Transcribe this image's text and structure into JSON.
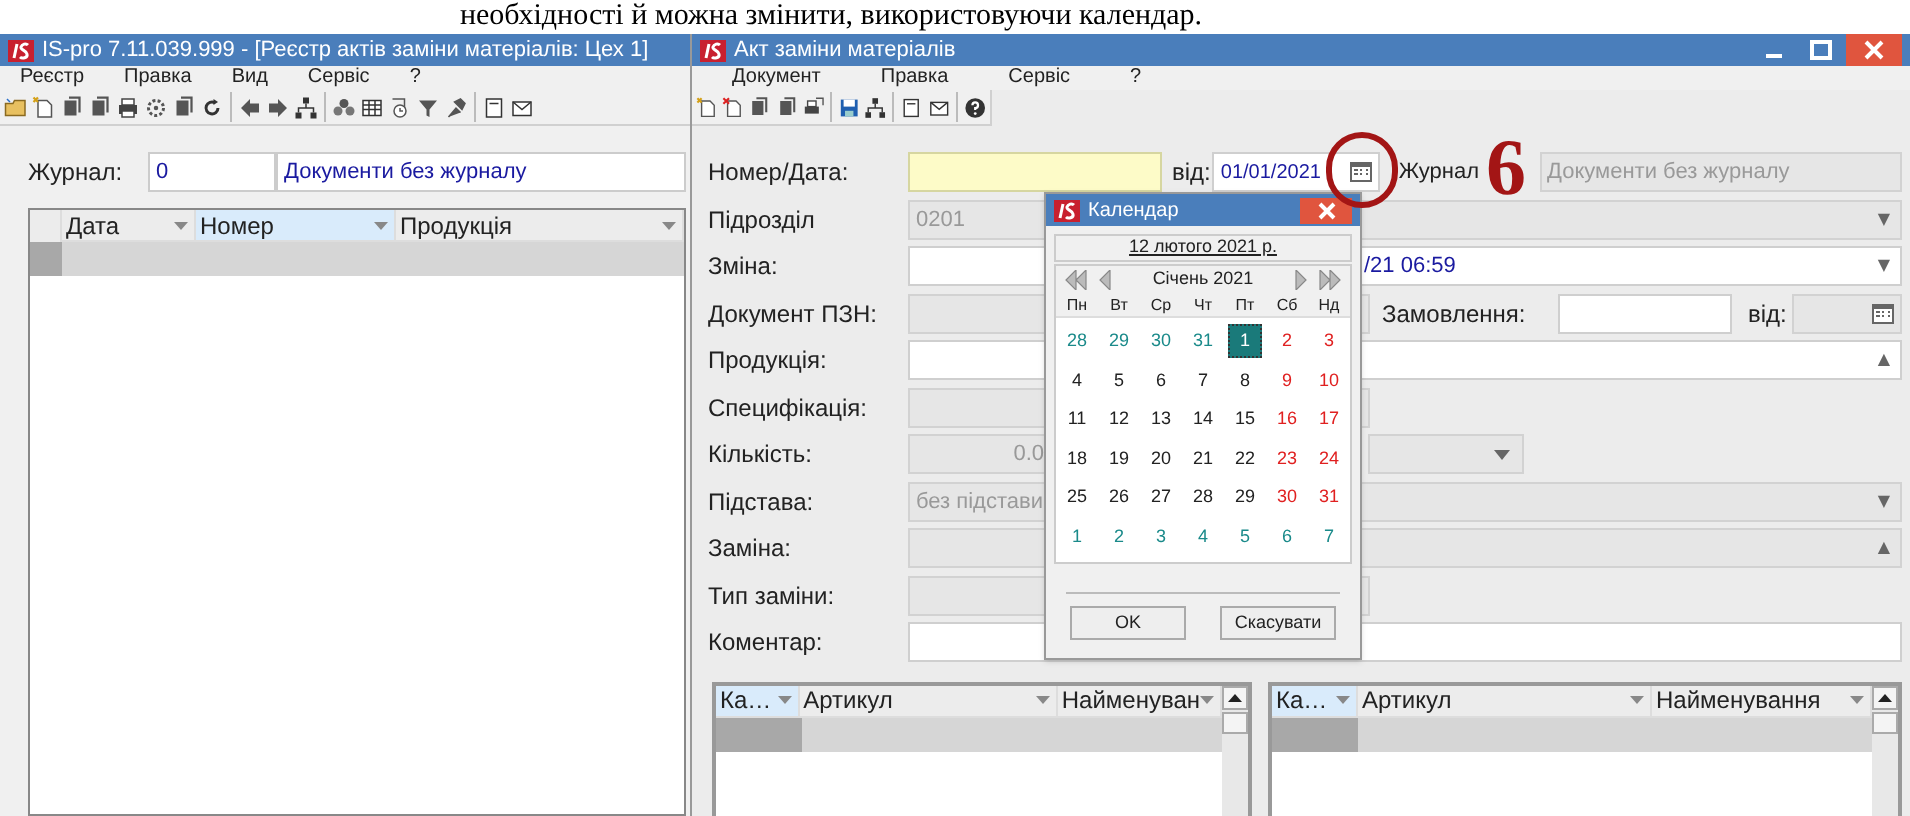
{
  "caption": "необхідності й можна змінити, використовуючи календар.",
  "annotation": {
    "number": "6"
  },
  "registry_window": {
    "title": "IS-pro 7.11.039.999 - [Реєстр актів заміни матеріалів: Цех 1]",
    "menu": [
      "Реєстр",
      "Правка",
      "Вид",
      "Сервіс",
      "?"
    ],
    "journal": {
      "label": "Журнал:",
      "code": "0",
      "name": "Документи без журналу"
    },
    "table": {
      "columns": [
        {
          "label": "Дата",
          "selected": false
        },
        {
          "label": "Номер",
          "selected": true
        },
        {
          "label": "Продукція",
          "selected": false
        }
      ]
    }
  },
  "act_window": {
    "title": "Акт заміни матеріалів",
    "menu": [
      "Документ",
      "Правка",
      "Сервіс",
      "?"
    ],
    "form": [
      {
        "kind": "number_date",
        "label": "Номер/Дата:",
        "date_label": "від:",
        "date": "01/01/2021",
        "journal_label": "Журнал",
        "journal": "Документи без журналу"
      },
      {
        "kind": "select",
        "label": "Підрозділ",
        "value": "0201",
        "disabled": true,
        "caret": "▼"
      },
      {
        "kind": "covered_select",
        "label": "Зміна:",
        "value": "/21 06:59",
        "disabled": false,
        "caret": "▼"
      },
      {
        "kind": "document_order",
        "label": "Документ ПЗН:",
        "order_label": "Замовлення:",
        "date_label": "від:"
      },
      {
        "kind": "select",
        "label": "Продукція:",
        "disabled": false,
        "caret": "▲"
      },
      {
        "kind": "short",
        "label": "Специфікація:",
        "disabled": true
      },
      {
        "kind": "quantity",
        "label": "Кількість:",
        "value": "0.0",
        "disabled": true
      },
      {
        "kind": "select",
        "label": "Підстава:",
        "value": "без підстави",
        "disabled": true,
        "caret": "▼"
      },
      {
        "kind": "select",
        "label": "Заміна:",
        "disabled": true,
        "caret": "▲"
      },
      {
        "kind": "short",
        "label": "Тип заміни:",
        "disabled": true
      },
      {
        "kind": "text",
        "label": "Коментар:",
        "disabled": false
      }
    ],
    "tables": [
      {
        "columns": [
          {
            "label": "Ка…",
            "selected": true
          },
          {
            "label": "Артикул",
            "selected": false
          },
          {
            "label": "Найменуван",
            "selected": false
          }
        ]
      },
      {
        "columns": [
          {
            "label": "Ка…",
            "selected": true
          },
          {
            "label": "Артикул",
            "selected": false
          },
          {
            "label": "Найменування",
            "selected": false
          }
        ]
      }
    ]
  },
  "calendar": {
    "title": "Календар",
    "today": "12 лютого 2021 р.",
    "month": "Січень 2021",
    "weekdays": [
      "Пн",
      "Вт",
      "Ср",
      "Чт",
      "Пт",
      "Сб",
      "Нд"
    ],
    "weeks": [
      [
        {
          "day": "28",
          "kind": "other",
          "selected": false
        },
        {
          "day": "29",
          "kind": "other",
          "selected": false
        },
        {
          "day": "30",
          "kind": "other",
          "selected": false
        },
        {
          "day": "31",
          "kind": "other",
          "selected": false
        },
        {
          "day": "1",
          "kind": "day",
          "selected": true
        },
        {
          "day": "2",
          "kind": "weekend",
          "selected": false
        },
        {
          "day": "3",
          "kind": "weekend",
          "selected": false
        }
      ],
      [
        {
          "day": "4",
          "kind": "day",
          "selected": false
        },
        {
          "day": "5",
          "kind": "day",
          "selected": false
        },
        {
          "day": "6",
          "kind": "day",
          "selected": false
        },
        {
          "day": "7",
          "kind": "day",
          "selected": false
        },
        {
          "day": "8",
          "kind": "day",
          "selected": false
        },
        {
          "day": "9",
          "kind": "weekend",
          "selected": false
        },
        {
          "day": "10",
          "kind": "weekend",
          "selected": false
        }
      ],
      [
        {
          "day": "11",
          "kind": "day",
          "selected": false
        },
        {
          "day": "12",
          "kind": "day",
          "selected": false
        },
        {
          "day": "13",
          "kind": "day",
          "selected": false
        },
        {
          "day": "14",
          "kind": "day",
          "selected": false
        },
        {
          "day": "15",
          "kind": "day",
          "selected": false
        },
        {
          "day": "16",
          "kind": "weekend",
          "selected": false
        },
        {
          "day": "17",
          "kind": "weekend",
          "selected": false
        }
      ],
      [
        {
          "day": "18",
          "kind": "day",
          "selected": false
        },
        {
          "day": "19",
          "kind": "day",
          "selected": false
        },
        {
          "day": "20",
          "kind": "day",
          "selected": false
        },
        {
          "day": "21",
          "kind": "day",
          "selected": false
        },
        {
          "day": "22",
          "kind": "day",
          "selected": false
        },
        {
          "day": "23",
          "kind": "weekend",
          "selected": false
        },
        {
          "day": "24",
          "kind": "weekend",
          "selected": false
        }
      ],
      [
        {
          "day": "25",
          "kind": "day",
          "selected": false
        },
        {
          "day": "26",
          "kind": "day",
          "selected": false
        },
        {
          "day": "27",
          "kind": "day",
          "selected": false
        },
        {
          "day": "28",
          "kind": "day",
          "selected": false
        },
        {
          "day": "29",
          "kind": "day",
          "selected": false
        },
        {
          "day": "30",
          "kind": "weekend",
          "selected": false
        },
        {
          "day": "31",
          "kind": "weekend",
          "selected": false
        }
      ],
      [
        {
          "day": "1",
          "kind": "other",
          "selected": false
        },
        {
          "day": "2",
          "kind": "other",
          "selected": false
        },
        {
          "day": "3",
          "kind": "other",
          "selected": false
        },
        {
          "day": "4",
          "kind": "other",
          "selected": false
        },
        {
          "day": "5",
          "kind": "other",
          "selected": false
        },
        {
          "day": "6",
          "kind": "other",
          "selected": false
        },
        {
          "day": "7",
          "kind": "other",
          "selected": false
        }
      ]
    ],
    "buttons": [
      "OK",
      "Скасувати"
    ]
  }
}
